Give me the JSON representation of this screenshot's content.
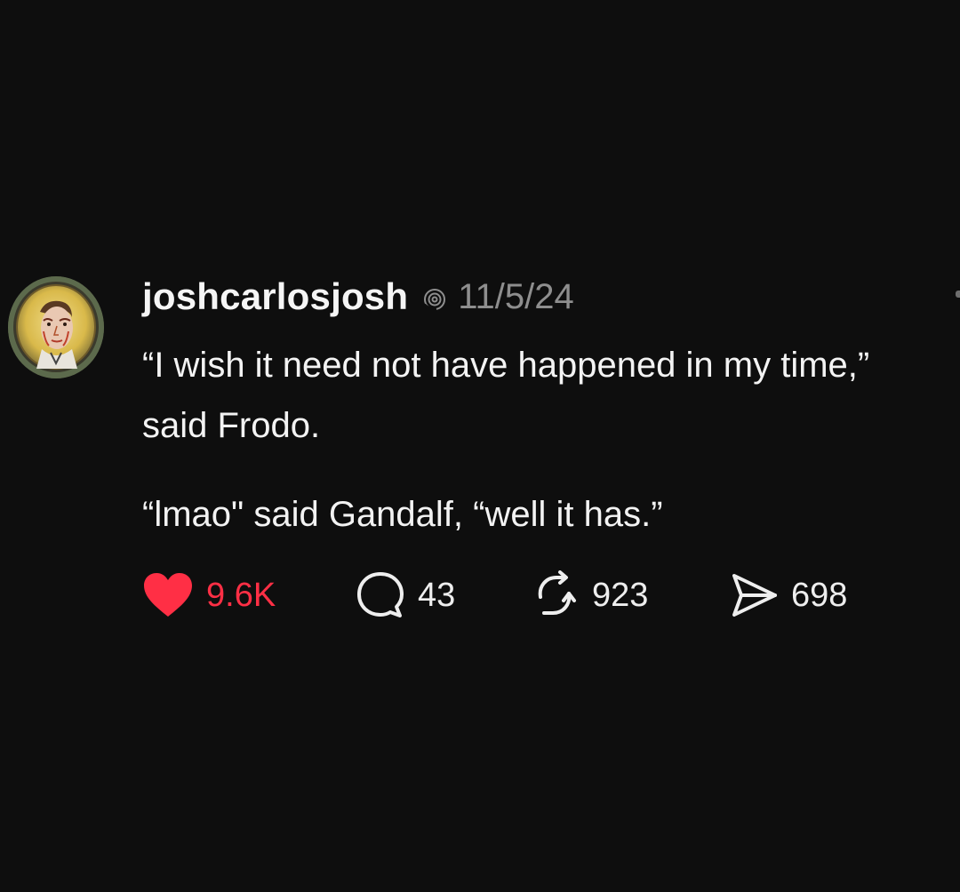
{
  "post": {
    "username": "joshcarlosjosh",
    "date": "11/5/24",
    "body": {
      "line1": "“I wish it need not have happened in my time,” said Frodo.",
      "line2": "“lmao\" said Gandalf, “well it has.”"
    },
    "actions": {
      "likes": "9.6K",
      "comments": "43",
      "reposts": "923",
      "shares": "698"
    }
  },
  "icons": {
    "verified": "threads-logo-icon",
    "like": "heart-icon",
    "comment": "speech-bubble-icon",
    "repost": "repost-arrows-icon",
    "share": "send-paper-plane-icon"
  },
  "colors": {
    "background": "#0e0e0e",
    "like_active": "#ff2f45",
    "muted": "#8e8e8e",
    "text": "#f3f3f3"
  }
}
